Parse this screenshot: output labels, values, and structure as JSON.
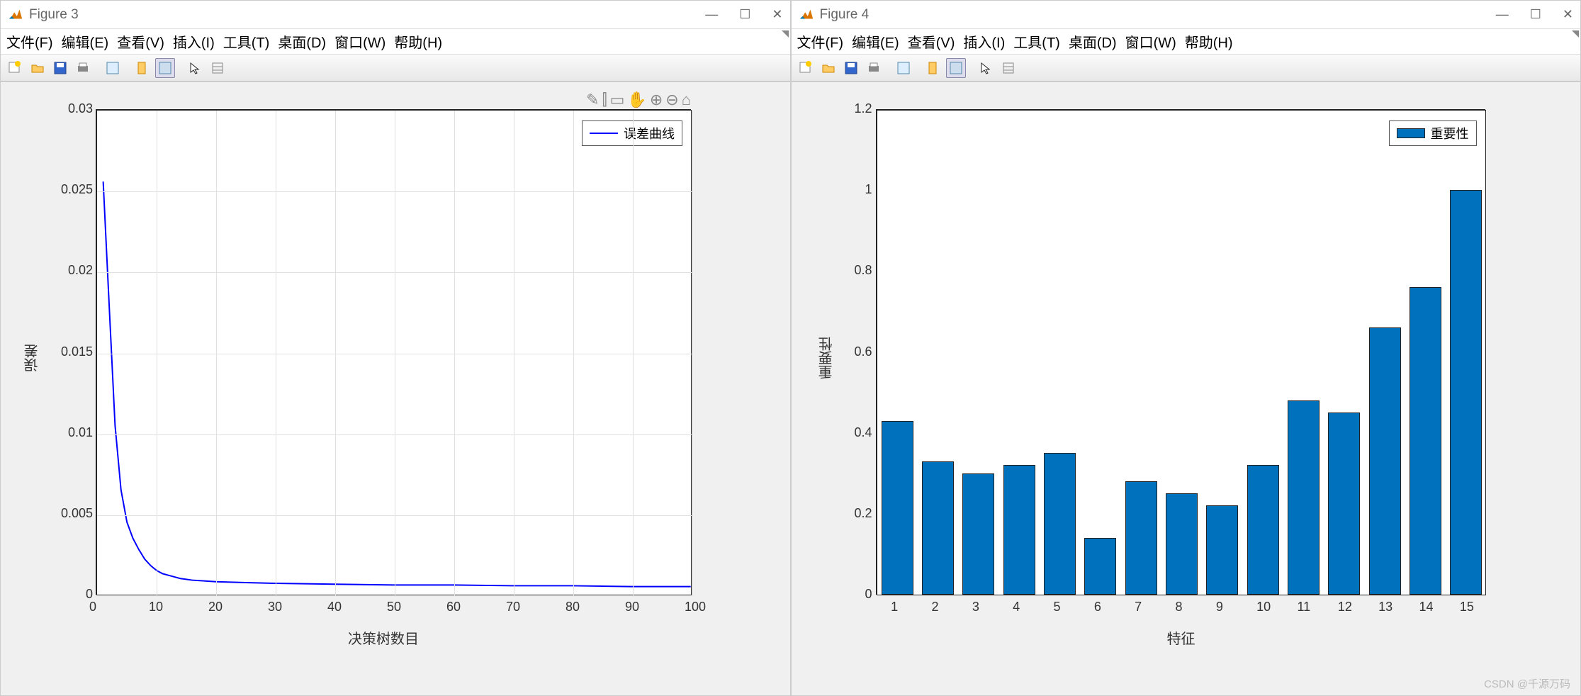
{
  "watermark": "CSDN @千源万码",
  "figure3": {
    "title": "Figure 3",
    "menus": [
      "文件(F)",
      "编辑(E)",
      "查看(V)",
      "插入(I)",
      "工具(T)",
      "桌面(D)",
      "窗口(W)",
      "帮助(H)"
    ],
    "legend": "误差曲线",
    "xlabel": "决策树数目",
    "ylabel": "误差",
    "yticks": [
      "0",
      "0.005",
      "0.01",
      "0.015",
      "0.02",
      "0.025",
      "0.03"
    ],
    "xticks": [
      "0",
      "10",
      "20",
      "30",
      "40",
      "50",
      "60",
      "70",
      "80",
      "90",
      "100"
    ]
  },
  "figure4": {
    "title": "Figure 4",
    "menus": [
      "文件(F)",
      "编辑(E)",
      "查看(V)",
      "插入(I)",
      "工具(T)",
      "桌面(D)",
      "窗口(W)",
      "帮助(H)"
    ],
    "legend": "重要性",
    "xlabel": "特征",
    "ylabel": "重要性",
    "yticks": [
      "0",
      "0.2",
      "0.4",
      "0.6",
      "0.8",
      "1",
      "1.2"
    ],
    "xticks": [
      "1",
      "2",
      "3",
      "4",
      "5",
      "6",
      "7",
      "8",
      "9",
      "10",
      "11",
      "12",
      "13",
      "14",
      "15"
    ]
  },
  "chart_data": [
    {
      "type": "line",
      "title": "",
      "xlabel": "决策树数目",
      "ylabel": "误差",
      "xlim": [
        0,
        100
      ],
      "ylim": [
        0,
        0.03
      ],
      "series": [
        {
          "name": "误差曲线",
          "x": [
            1,
            2,
            3,
            4,
            5,
            6,
            7,
            8,
            9,
            10,
            11,
            12,
            13,
            14,
            15,
            16,
            18,
            20,
            25,
            30,
            40,
            50,
            60,
            70,
            80,
            90,
            100
          ],
          "y": [
            0.0256,
            0.018,
            0.0105,
            0.0065,
            0.0045,
            0.0035,
            0.0028,
            0.0022,
            0.0018,
            0.0015,
            0.0013,
            0.0012,
            0.0011,
            0.001,
            0.00095,
            0.0009,
            0.00085,
            0.0008,
            0.00075,
            0.0007,
            0.00065,
            0.0006,
            0.0006,
            0.00055,
            0.00055,
            0.0005,
            0.0005
          ]
        }
      ],
      "legend_position": "top-right",
      "grid": true
    },
    {
      "type": "bar",
      "title": "",
      "xlabel": "特征",
      "ylabel": "重要性",
      "xlim": [
        0.5,
        15.5
      ],
      "ylim": [
        0,
        1.2
      ],
      "categories": [
        1,
        2,
        3,
        4,
        5,
        6,
        7,
        8,
        9,
        10,
        11,
        12,
        13,
        14,
        15
      ],
      "series": [
        {
          "name": "重要性",
          "values": [
            0.43,
            0.33,
            0.3,
            0.32,
            0.35,
            0.14,
            0.28,
            0.25,
            0.22,
            0.32,
            0.48,
            0.45,
            0.66,
            0.76,
            1.0
          ]
        }
      ],
      "legend_position": "top-right",
      "grid": false
    }
  ]
}
